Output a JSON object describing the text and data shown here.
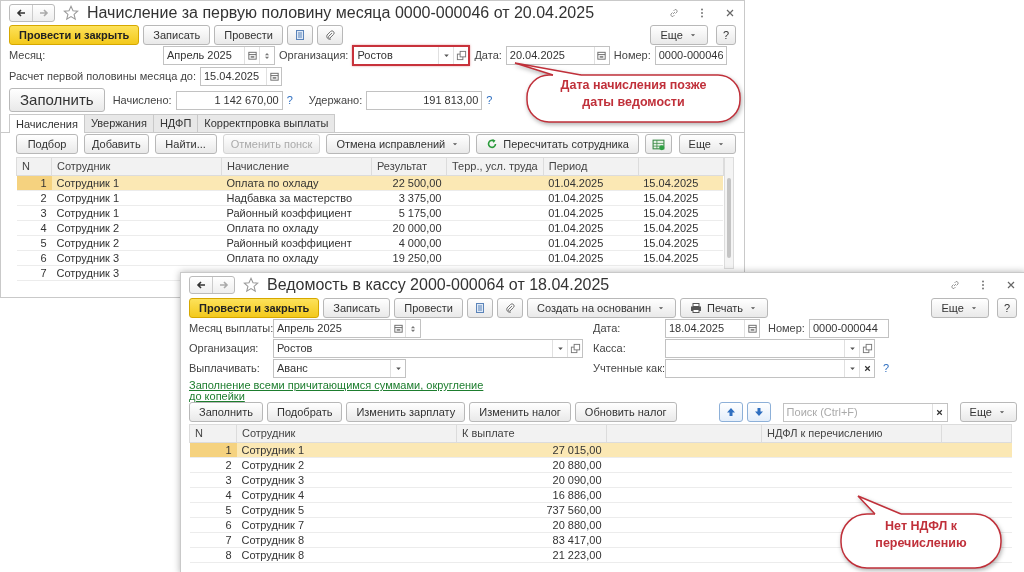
{
  "window_1": {
    "title": "Начисление за первую половину месяца 0000-000046 от 20.04.2025",
    "toolbar": [
      {
        "kind": "primary",
        "label": "Провести и закрыть"
      },
      {
        "kind": "button",
        "label": "Записать"
      },
      {
        "kind": "button",
        "label": "Провести"
      },
      {
        "kind": "list"
      },
      {
        "kind": "attach"
      }
    ],
    "more": "Еще",
    "help": "?",
    "month": {
      "label": "Месяц:",
      "value": "Апрель 2025"
    },
    "organization": {
      "label": "Организация:",
      "value": "Ростов",
      "highlighted": true
    },
    "date": {
      "label": "Дата:",
      "value": "20.04.2025"
    },
    "number": {
      "label": "Номер:",
      "value": "0000-000046"
    },
    "calc_until": {
      "label": "Расчет первой половины месяца до:",
      "value": "15.04.2025"
    },
    "fill_button": "Заполнить",
    "accrued": {
      "label": "Начислено:",
      "value": "1 142 670,00",
      "help": "?"
    },
    "withheld": {
      "label": "Удержано:",
      "value": "191 813,00",
      "help": "?"
    },
    "tabs": [
      {
        "label": "Начисления",
        "selected": true
      },
      {
        "label": "Увержания",
        "selected": false
      },
      {
        "label": "НДФП",
        "selected": false
      },
      {
        "label": "Корректпровка выплаты",
        "selected": false
      }
    ],
    "table_toolbar": [
      {
        "kind": "button",
        "label": "Подбор",
        "disabled": false
      },
      {
        "kind": "button",
        "label": "Добавить",
        "disabled": false
      },
      {
        "kind": "button",
        "label": "Найти...",
        "disabled": false
      },
      {
        "kind": "button",
        "label": "Отменить понск",
        "disabled": true
      },
      {
        "kind": "dropdown",
        "label": "Отмена исправлений",
        "disabled": false
      },
      {
        "kind": "refresh",
        "label": "Пересчитать сотрудника",
        "disabled": false
      },
      {
        "kind": "excel",
        "disabled": false
      }
    ],
    "table_more": "Еще",
    "table": {
      "columns": [
        "N",
        "Сотрудник",
        "Начисление",
        "Результат",
        "Терр., усл. труда",
        "Период"
      ],
      "rows": [
        {
          "n": "1",
          "employee": "Сотрудник 1",
          "accrual": "Оплата по охладу",
          "result": "22 500,00",
          "period_start": "01.04.2025",
          "period_end": "15.04.2025",
          "selected": true
        },
        {
          "n": "2",
          "employee": "Сотрудник 1",
          "accrual": "Надбавка за мастерство",
          "result": "3 375,00",
          "period_start": "01.04.2025",
          "period_end": "15.04.2025",
          "selected": false
        },
        {
          "n": "3",
          "employee": "Сотрудник 1",
          "accrual": "Районный коэффициент",
          "result": "5 175,00",
          "period_start": "01.04.2025",
          "period_end": "15.04.2025",
          "selected": false
        },
        {
          "n": "4",
          "employee": "Сотрудник 2",
          "accrual": "Оплата по охладу",
          "result": "20 000,00",
          "period_start": "01.04.2025",
          "period_end": "15.04.2025",
          "selected": false
        },
        {
          "n": "5",
          "employee": "Сотрудник 2",
          "accrual": "Районный коэффициент",
          "result": "4 000,00",
          "period_start": "01.04.2025",
          "period_end": "15.04.2025",
          "selected": false
        },
        {
          "n": "6",
          "employee": "Сотрудник 3",
          "accrual": "Оплата по охладу",
          "result": "19 250,00",
          "period_start": "01.04.2025",
          "period_end": "15.04.2025",
          "selected": false
        },
        {
          "n": "7",
          "employee": "Сотрудник 3",
          "selected": false
        }
      ]
    }
  },
  "window_2": {
    "title": "Ведомость в кассу 2000-000064 от 18.04.2025",
    "toolbar": [
      {
        "kind": "primary",
        "label": "Провести и закрыть"
      },
      {
        "kind": "button",
        "label": "Записать"
      },
      {
        "kind": "button",
        "label": "Провести"
      },
      {
        "kind": "list"
      },
      {
        "kind": "attach"
      },
      {
        "kind": "dropdown",
        "label": "Создать на основанин"
      },
      {
        "kind": "print",
        "label": "Печать"
      }
    ],
    "more": "Еще",
    "help": "?",
    "month": {
      "label": "Месяц выплаты:",
      "value": "Апрель 2025"
    },
    "date": {
      "label": "Дата:",
      "value": "18.04.2025"
    },
    "number": {
      "label": "Номер:",
      "value": "0000-000044"
    },
    "organization": {
      "label": "Организация:",
      "value": "Ростов"
    },
    "cashbox": {
      "label": "Касса:"
    },
    "pay": {
      "label": "Выплачивать:",
      "value": "Аванс"
    },
    "accounted_as": {
      "label": "Учтенные как:",
      "help": "?"
    },
    "fill_link": "Заполнение всеми причитающимся суммами, округление до копейки",
    "table_toolbar": [
      {
        "kind": "button",
        "label": "Заполнить"
      },
      {
        "kind": "button",
        "label": "Подобрать"
      },
      {
        "kind": "button",
        "label": "Изменить зарплату"
      },
      {
        "kind": "button",
        "label": "Изменить налог"
      },
      {
        "kind": "button",
        "label": "Обновить налог"
      }
    ],
    "search": {
      "placeholder": "Поиск (Ctrl+F)"
    },
    "table_more": "Еще",
    "table": {
      "columns": [
        "N",
        "Сотрудник",
        "К выплате",
        "НДФЛ к перечислению"
      ],
      "rows": [
        {
          "n": "1",
          "employee": "Сотрудник 1",
          "amount": "27 015,00",
          "selected": true
        },
        {
          "n": "2",
          "employee": "Сотрудник 2",
          "amount": "20 880,00",
          "selected": false
        },
        {
          "n": "3",
          "employee": "Сотрудник 3",
          "amount": "20 090,00",
          "selected": false
        },
        {
          "n": "4",
          "employee": "Сотрудник 4",
          "amount": "16 886,00",
          "selected": false
        },
        {
          "n": "5",
          "employee": "Сотрудник 5",
          "amount": "737 560,00",
          "selected": false
        },
        {
          "n": "6",
          "employee": "Сотрудник 7",
          "amount": "20 880,00",
          "selected": false
        },
        {
          "n": "7",
          "employee": "Сотрудник 8",
          "amount": "83 417,00",
          "selected": false
        },
        {
          "n": "8",
          "employee": "Сотрудник 8",
          "amount": "21 223,00",
          "selected": false
        }
      ]
    }
  },
  "callouts": [
    {
      "text": "Дата начисления позже даты ведомости"
    },
    {
      "text": "Нет НДФЛ к перечислению"
    }
  ]
}
